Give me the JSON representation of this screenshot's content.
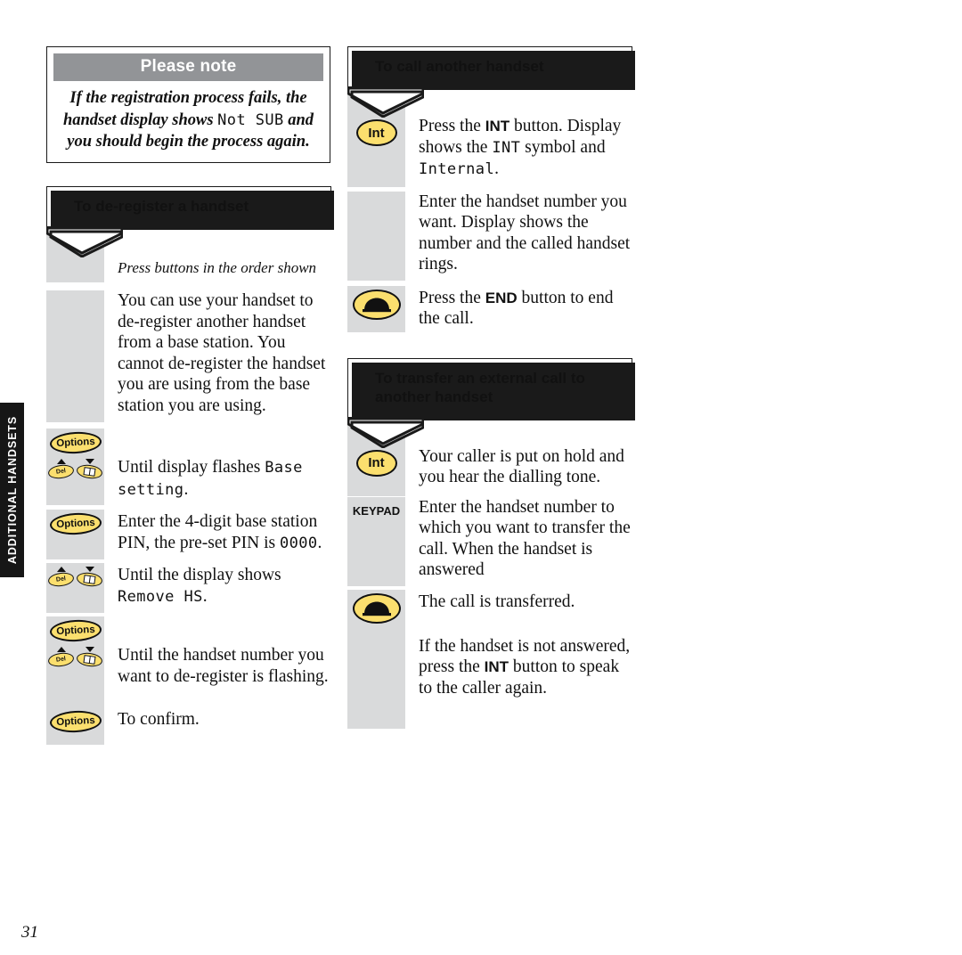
{
  "page": {
    "number": "31",
    "section_tab": "ADDITIONAL HANDSETS"
  },
  "colors": {
    "key_yellow": "#fbdf6e",
    "gutter_gray": "#d9dadb",
    "note_header_gray": "#929497",
    "ink": "#111111",
    "tab_black": "#161616"
  },
  "note_panel": {
    "title": "Please note",
    "body_part1": "If the registration process fails, the handset display shows ",
    "body_lcd": "Not SUB",
    "body_part2": " and you should begin the process again."
  },
  "left_section": {
    "heading": "To de-register a handset",
    "intro": "Press buttons in the order shown",
    "steps": [
      {
        "icon": "none",
        "icon_label": "",
        "text_part1": "You can use your handset to de-register another handset from a base station. You cannot de-register the handset you are using from the base station you are using.",
        "text_lcd": "",
        "text_part2": ""
      },
      {
        "icon": "options-key",
        "icon_label": "Options",
        "text_part1": "",
        "text_lcd": "",
        "text_part2": ""
      },
      {
        "icon": "updown-key-pair",
        "icon_label": "Del",
        "text_part1": "Until display flashes ",
        "text_lcd": "Base setting",
        "text_part2": "."
      },
      {
        "icon": "options-key",
        "icon_label": "Options",
        "text_part1": "Enter the 4-digit base station PIN, the pre-set PIN is ",
        "text_lcd": "0000",
        "text_part2": "."
      },
      {
        "icon": "updown-key-pair",
        "icon_label": "Del",
        "text_part1": "Until the display shows ",
        "text_lcd": "Remove HS",
        "text_part2": "."
      },
      {
        "icon": "options-key",
        "icon_label": "Options",
        "text_part1": "",
        "text_lcd": "",
        "text_part2": ""
      },
      {
        "icon": "updown-key-pair",
        "icon_label": "Del",
        "text_part1": "Until the handset number you want to de-register is flashing.",
        "text_lcd": "",
        "text_part2": ""
      },
      {
        "icon": "options-key",
        "icon_label": "Options",
        "text_part1": "To confirm.",
        "text_lcd": "",
        "text_part2": ""
      }
    ]
  },
  "right_section_call": {
    "heading": "To call another handset",
    "steps": [
      {
        "icon": "int-key",
        "icon_label": "Int",
        "text_part1": "Press the ",
        "text_kbd": "INT",
        "text_part2": " button. Display shows the ",
        "text_lcd1": "INT",
        "text_part3": " symbol and ",
        "text_lcd2": "Internal",
        "text_part4": "."
      },
      {
        "icon": "none",
        "icon_label": "",
        "text_part1": "Enter the handset number you want. Display shows the number and the called handset rings.",
        "text_kbd": "",
        "text_part2": ""
      },
      {
        "icon": "end-key",
        "icon_label": "END",
        "text_part1": "Press the ",
        "text_kbd": "END",
        "text_part2": " button to end the call."
      }
    ]
  },
  "right_section_transfer": {
    "heading_line1": "To transfer an external call to",
    "heading_line2": "another handset",
    "steps": [
      {
        "icon": "int-key",
        "icon_label": "Int",
        "text_part1": "Your caller is put on hold and you hear the dialling tone.",
        "text_kbd": "",
        "text_part2": ""
      },
      {
        "icon": "keypad-label",
        "icon_label": "KEYPAD",
        "text_part1": "Enter the handset number to which you want to transfer the call. When the handset is answered",
        "text_kbd": "",
        "text_part2": ""
      },
      {
        "icon": "end-key",
        "icon_label": "END",
        "text_part1": "The call is transferred.",
        "text_kbd": "",
        "text_part2": ""
      },
      {
        "icon": "none",
        "icon_label": "",
        "text_part1": "If the handset is not answered, press the ",
        "text_kbd": "INT",
        "text_part2": " button to speak to the caller again."
      }
    ]
  }
}
